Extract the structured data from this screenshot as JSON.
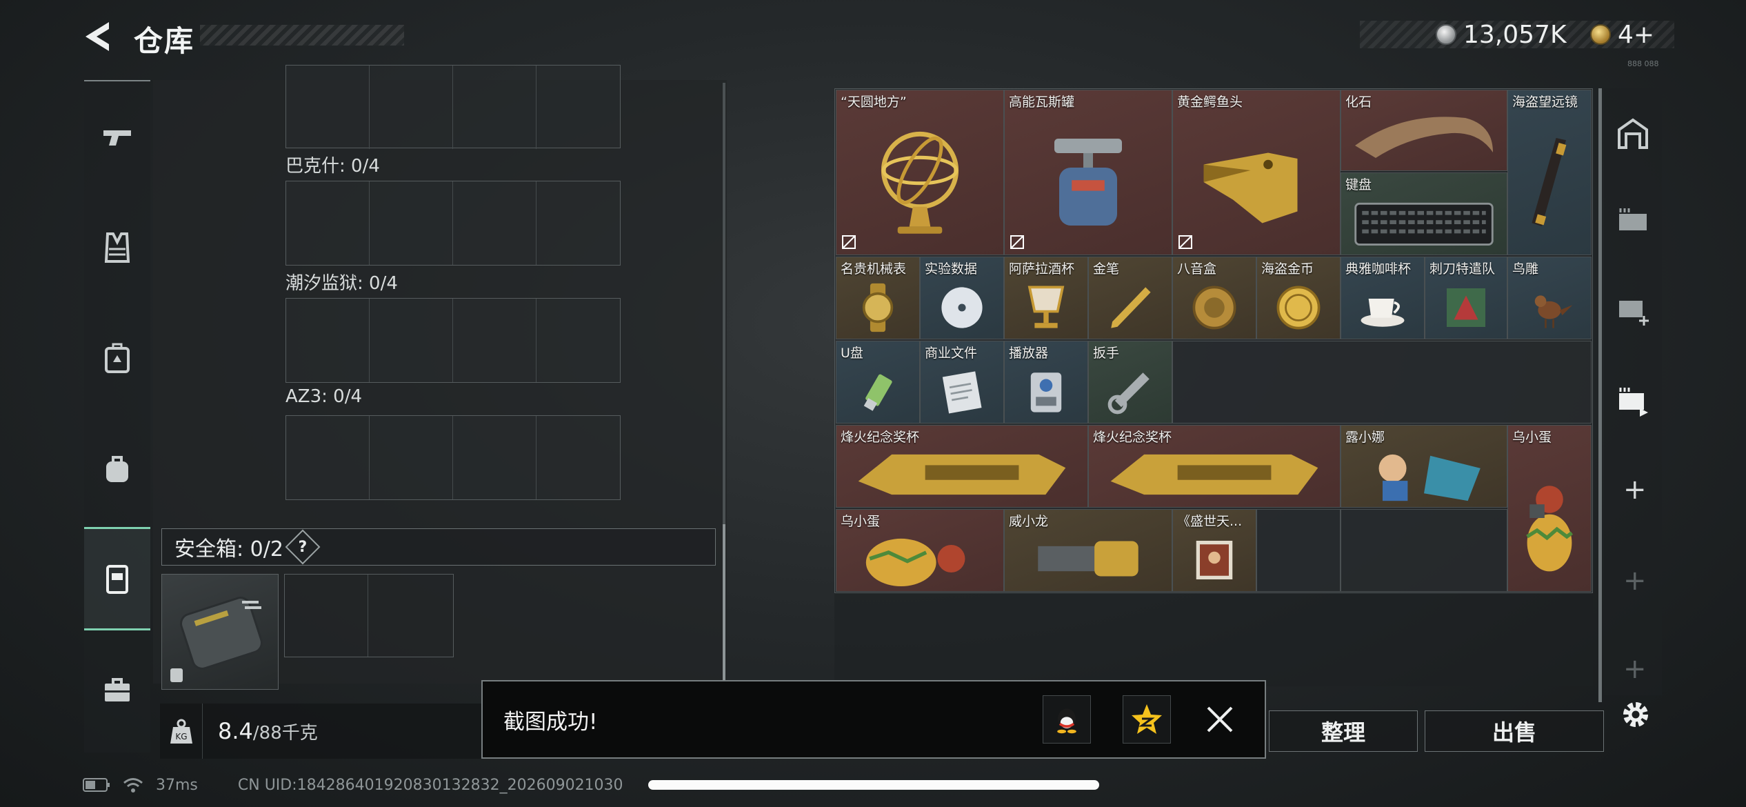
{
  "header": {
    "title": "仓库",
    "currency_silver": "13,057K",
    "currency_gold": "4+",
    "tiny_code": "888 088"
  },
  "nav": {
    "items": [
      "weapons",
      "armor",
      "backpack",
      "bag",
      "safe-box",
      "toolbox"
    ],
    "active": "safe-box"
  },
  "stash": {
    "containers": [
      {
        "label": "巴克什: 0/4"
      },
      {
        "label": "潮汐监狱: 0/4"
      },
      {
        "label": "AZ3: 0/4"
      }
    ],
    "safe_box_label": "安全箱: 0/2",
    "safe_help": "?",
    "weight_value": "8.4",
    "weight_max": "/88千克",
    "weight_icon_text": "KG"
  },
  "inventory": {
    "items": [
      {
        "name": "“天圆地方”",
        "bg": "red"
      },
      {
        "name": "高能瓦斯罐",
        "bg": "red"
      },
      {
        "name": "黄金鳄鱼头",
        "bg": "red"
      },
      {
        "name": "化石",
        "bg": "red"
      },
      {
        "name": "海盗望远镜",
        "bg": "blue"
      },
      {
        "name": "键盘",
        "bg": "green"
      },
      {
        "name": "名贵机械表",
        "bg": "gold"
      },
      {
        "name": "实验数据",
        "bg": "blue"
      },
      {
        "name": "阿萨拉酒杯",
        "bg": "gold"
      },
      {
        "name": "金笔",
        "bg": "gold"
      },
      {
        "name": "八音盒",
        "bg": "gold"
      },
      {
        "name": "海盗金币",
        "bg": "gold"
      },
      {
        "name": "典雅咖啡杯",
        "bg": "blue"
      },
      {
        "name": "刺刀特遣队",
        "bg": "blue"
      },
      {
        "name": "鸟雕",
        "bg": "blue"
      },
      {
        "name": "U盘",
        "bg": "blue"
      },
      {
        "name": "商业文件",
        "bg": "blue"
      },
      {
        "name": "播放器",
        "bg": "blue"
      },
      {
        "name": "扳手",
        "bg": "green"
      },
      {
        "name": "烽火纪念奖杯",
        "bg": "red"
      },
      {
        "name": "烽火纪念奖杯",
        "bg": "red"
      },
      {
        "name": "露小娜",
        "bg": "gold"
      },
      {
        "name": "乌小蛋",
        "bg": "red"
      },
      {
        "name": "乌小蛋",
        "bg": "gold"
      },
      {
        "name": "威小龙",
        "bg": "gold"
      },
      {
        "name": "《盛世天...",
        "bg": "gold"
      }
    ]
  },
  "buttons": {
    "organize": "整理",
    "sell": "出售"
  },
  "toast": {
    "text": "截图成功!",
    "qq_icon": "qq-icon",
    "qzone_icon": "qzone-star-icon"
  },
  "status": {
    "ping": "37ms",
    "uid": "CN UID:18428640192083013283​2_202609021030"
  }
}
